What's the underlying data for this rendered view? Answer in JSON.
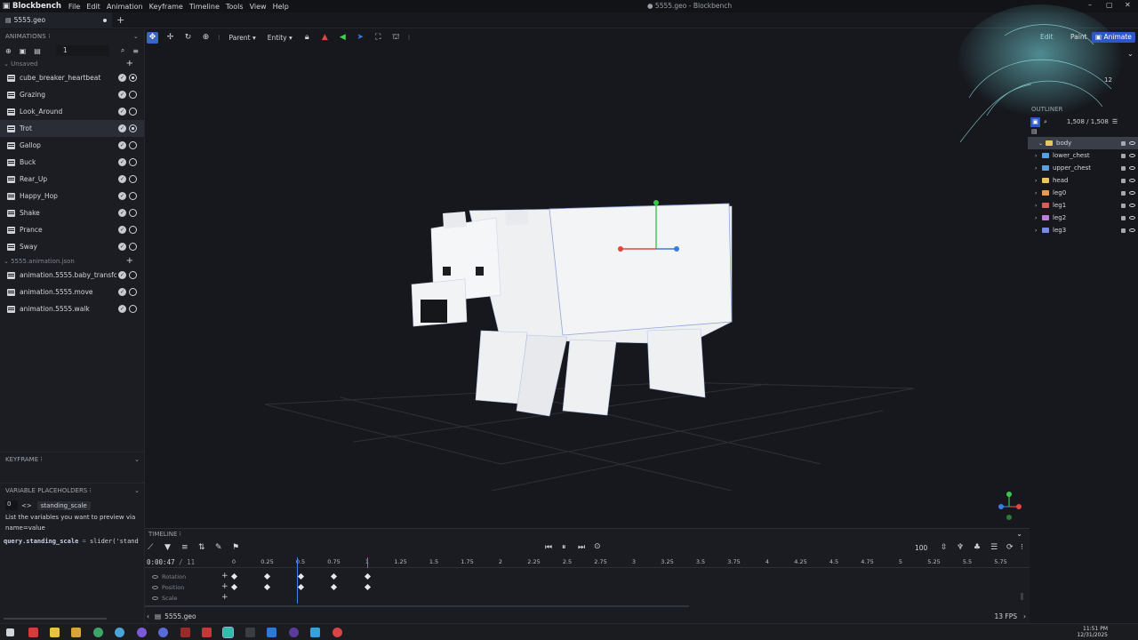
{
  "app": {
    "name": "Blockbench",
    "window_title": "● 5555.geo - Blockbench",
    "menus": [
      "File",
      "Edit",
      "Animation",
      "Keyframe",
      "Timeline",
      "Tools",
      "View",
      "Help"
    ]
  },
  "tabs": [
    {
      "label": "5555.geo"
    }
  ],
  "left_panel": {
    "animations_header": "ANIMATIONS",
    "search_value": "1",
    "groups": [
      {
        "title": "Unsaved",
        "items": [
          {
            "label": "cube_breaker_heartbeat",
            "playing": true
          },
          {
            "label": "Grazing",
            "playing": false
          },
          {
            "label": "Look_Around",
            "playing": false
          },
          {
            "label": "Trot",
            "playing": true,
            "selected": true
          },
          {
            "label": "Gallop",
            "playing": false
          },
          {
            "label": "Buck",
            "playing": false
          },
          {
            "label": "Rear_Up",
            "playing": false
          },
          {
            "label": "Happy_Hop",
            "playing": false
          },
          {
            "label": "Shake",
            "playing": false
          },
          {
            "label": "Prance",
            "playing": false
          },
          {
            "label": "Sway",
            "playing": false
          }
        ]
      },
      {
        "title": "5555.animation.json",
        "items": [
          {
            "label": "animation.5555.baby_transform",
            "playing": false
          },
          {
            "label": "animation.5555.move",
            "playing": false
          },
          {
            "label": "animation.5555.walk",
            "playing": false
          }
        ]
      }
    ],
    "keyframe_header": "KEYFRAME",
    "variable_header": "VARIABLE PLACEHOLDERS",
    "variable_index": "0",
    "variable_name": "standing_scale",
    "variable_help": "List the variables you want to preview via name=value",
    "variable_code_key": "query.standing_scale",
    "variable_code_eq": "=",
    "variable_code_val": "slider('stand"
  },
  "viewport_toolbar": {
    "pivot_select": "Parent",
    "space_select": "Entity"
  },
  "modes": {
    "paint": "Paint",
    "animate": "Animate"
  },
  "outliner": {
    "header": "OUTLINER",
    "count": "1,508 / 1,508",
    "side_value": "12",
    "items": [
      {
        "label": "body",
        "color": "#e8c660",
        "selected": true
      },
      {
        "label": "lower_chest",
        "color": "#5aa0e0"
      },
      {
        "label": "upper_chest",
        "color": "#5aa0e0"
      },
      {
        "label": "head",
        "color": "#e8c660"
      },
      {
        "label": "leg0",
        "color": "#e89a4a"
      },
      {
        "label": "leg1",
        "color": "#e05858"
      },
      {
        "label": "leg2",
        "color": "#c07ae0"
      },
      {
        "label": "leg3",
        "color": "#7a8ae8"
      }
    ]
  },
  "timeline": {
    "header": "TIMELINE",
    "time": "0:00:47",
    "time_sep": "/",
    "time_total": "11",
    "speed": "100",
    "ticks": [
      "0",
      "0.25",
      "0.5",
      "0.75",
      "1",
      "1.25",
      "1.5",
      "1.75",
      "2",
      "2.25",
      "2.5",
      "2.75",
      "3",
      "3.25",
      "3.5",
      "3.75",
      "4",
      "4.25",
      "4.5",
      "4.75",
      "5",
      "5.25",
      "5.5",
      "5.75"
    ],
    "channels": [
      "Rotation",
      "Position",
      "Scale"
    ],
    "keyframes_seconds": {
      "Rotation": [
        0,
        0.25,
        0.5,
        0.75,
        1.0
      ],
      "Position": [
        0,
        0.25,
        0.5,
        0.75,
        1.0
      ],
      "Scale": []
    },
    "playhead_seconds": 0.47,
    "end_marker_seconds": 1.0
  },
  "status": {
    "file": "5555.geo",
    "fps": "13 FPS"
  },
  "taskbar": {
    "time": "11:51 PM",
    "date": "12/31/2025"
  }
}
